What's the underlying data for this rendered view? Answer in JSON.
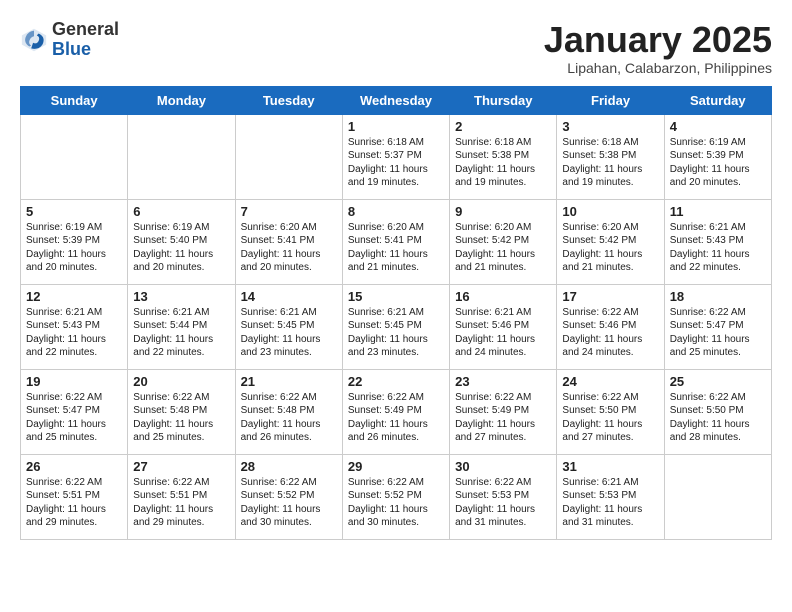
{
  "header": {
    "logo_general": "General",
    "logo_blue": "Blue",
    "month_title": "January 2025",
    "location": "Lipahan, Calabarzon, Philippines"
  },
  "days_of_week": [
    "Sunday",
    "Monday",
    "Tuesday",
    "Wednesday",
    "Thursday",
    "Friday",
    "Saturday"
  ],
  "weeks": [
    [
      {
        "day": "",
        "info": ""
      },
      {
        "day": "",
        "info": ""
      },
      {
        "day": "",
        "info": ""
      },
      {
        "day": "1",
        "info": "Sunrise: 6:18 AM\nSunset: 5:37 PM\nDaylight: 11 hours\nand 19 minutes."
      },
      {
        "day": "2",
        "info": "Sunrise: 6:18 AM\nSunset: 5:38 PM\nDaylight: 11 hours\nand 19 minutes."
      },
      {
        "day": "3",
        "info": "Sunrise: 6:18 AM\nSunset: 5:38 PM\nDaylight: 11 hours\nand 19 minutes."
      },
      {
        "day": "4",
        "info": "Sunrise: 6:19 AM\nSunset: 5:39 PM\nDaylight: 11 hours\nand 20 minutes."
      }
    ],
    [
      {
        "day": "5",
        "info": "Sunrise: 6:19 AM\nSunset: 5:39 PM\nDaylight: 11 hours\nand 20 minutes."
      },
      {
        "day": "6",
        "info": "Sunrise: 6:19 AM\nSunset: 5:40 PM\nDaylight: 11 hours\nand 20 minutes."
      },
      {
        "day": "7",
        "info": "Sunrise: 6:20 AM\nSunset: 5:41 PM\nDaylight: 11 hours\nand 20 minutes."
      },
      {
        "day": "8",
        "info": "Sunrise: 6:20 AM\nSunset: 5:41 PM\nDaylight: 11 hours\nand 21 minutes."
      },
      {
        "day": "9",
        "info": "Sunrise: 6:20 AM\nSunset: 5:42 PM\nDaylight: 11 hours\nand 21 minutes."
      },
      {
        "day": "10",
        "info": "Sunrise: 6:20 AM\nSunset: 5:42 PM\nDaylight: 11 hours\nand 21 minutes."
      },
      {
        "day": "11",
        "info": "Sunrise: 6:21 AM\nSunset: 5:43 PM\nDaylight: 11 hours\nand 22 minutes."
      }
    ],
    [
      {
        "day": "12",
        "info": "Sunrise: 6:21 AM\nSunset: 5:43 PM\nDaylight: 11 hours\nand 22 minutes."
      },
      {
        "day": "13",
        "info": "Sunrise: 6:21 AM\nSunset: 5:44 PM\nDaylight: 11 hours\nand 22 minutes."
      },
      {
        "day": "14",
        "info": "Sunrise: 6:21 AM\nSunset: 5:45 PM\nDaylight: 11 hours\nand 23 minutes."
      },
      {
        "day": "15",
        "info": "Sunrise: 6:21 AM\nSunset: 5:45 PM\nDaylight: 11 hours\nand 23 minutes."
      },
      {
        "day": "16",
        "info": "Sunrise: 6:21 AM\nSunset: 5:46 PM\nDaylight: 11 hours\nand 24 minutes."
      },
      {
        "day": "17",
        "info": "Sunrise: 6:22 AM\nSunset: 5:46 PM\nDaylight: 11 hours\nand 24 minutes."
      },
      {
        "day": "18",
        "info": "Sunrise: 6:22 AM\nSunset: 5:47 PM\nDaylight: 11 hours\nand 25 minutes."
      }
    ],
    [
      {
        "day": "19",
        "info": "Sunrise: 6:22 AM\nSunset: 5:47 PM\nDaylight: 11 hours\nand 25 minutes."
      },
      {
        "day": "20",
        "info": "Sunrise: 6:22 AM\nSunset: 5:48 PM\nDaylight: 11 hours\nand 25 minutes."
      },
      {
        "day": "21",
        "info": "Sunrise: 6:22 AM\nSunset: 5:48 PM\nDaylight: 11 hours\nand 26 minutes."
      },
      {
        "day": "22",
        "info": "Sunrise: 6:22 AM\nSunset: 5:49 PM\nDaylight: 11 hours\nand 26 minutes."
      },
      {
        "day": "23",
        "info": "Sunrise: 6:22 AM\nSunset: 5:49 PM\nDaylight: 11 hours\nand 27 minutes."
      },
      {
        "day": "24",
        "info": "Sunrise: 6:22 AM\nSunset: 5:50 PM\nDaylight: 11 hours\nand 27 minutes."
      },
      {
        "day": "25",
        "info": "Sunrise: 6:22 AM\nSunset: 5:50 PM\nDaylight: 11 hours\nand 28 minutes."
      }
    ],
    [
      {
        "day": "26",
        "info": "Sunrise: 6:22 AM\nSunset: 5:51 PM\nDaylight: 11 hours\nand 29 minutes."
      },
      {
        "day": "27",
        "info": "Sunrise: 6:22 AM\nSunset: 5:51 PM\nDaylight: 11 hours\nand 29 minutes."
      },
      {
        "day": "28",
        "info": "Sunrise: 6:22 AM\nSunset: 5:52 PM\nDaylight: 11 hours\nand 30 minutes."
      },
      {
        "day": "29",
        "info": "Sunrise: 6:22 AM\nSunset: 5:52 PM\nDaylight: 11 hours\nand 30 minutes."
      },
      {
        "day": "30",
        "info": "Sunrise: 6:22 AM\nSunset: 5:53 PM\nDaylight: 11 hours\nand 31 minutes."
      },
      {
        "day": "31",
        "info": "Sunrise: 6:21 AM\nSunset: 5:53 PM\nDaylight: 11 hours\nand 31 minutes."
      },
      {
        "day": "",
        "info": ""
      }
    ]
  ]
}
